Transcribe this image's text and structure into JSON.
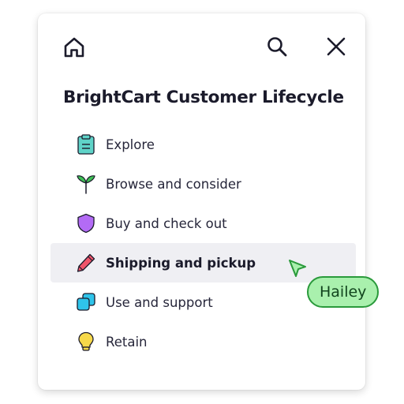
{
  "header": {
    "home_icon": "home-icon",
    "search_icon": "search-icon",
    "close_icon": "close-icon"
  },
  "title": "BrightCart Customer Lifecycle",
  "menu": {
    "items": [
      {
        "label": "Explore",
        "icon": "clipboard-icon",
        "color": "#5fd3c8",
        "active": false
      },
      {
        "label": "Browse and consider",
        "icon": "sprout-icon",
        "color": "#3fbf55",
        "active": false
      },
      {
        "label": "Buy and check out",
        "icon": "shield-icon",
        "color": "#b36bf5",
        "active": false
      },
      {
        "label": "Shipping and pickup",
        "icon": "pencil-icon",
        "color": "#f0546a",
        "active": true
      },
      {
        "label": "Use and support",
        "icon": "copy-cards-icon",
        "color": "#2fc4ea",
        "active": false
      },
      {
        "label": "Retain",
        "icon": "lightbulb-icon",
        "color": "#f7d94a",
        "active": false
      }
    ]
  },
  "collaborator": {
    "name": "Hailey",
    "color": "#a9f0ad",
    "border_color": "#2a9a3b"
  }
}
